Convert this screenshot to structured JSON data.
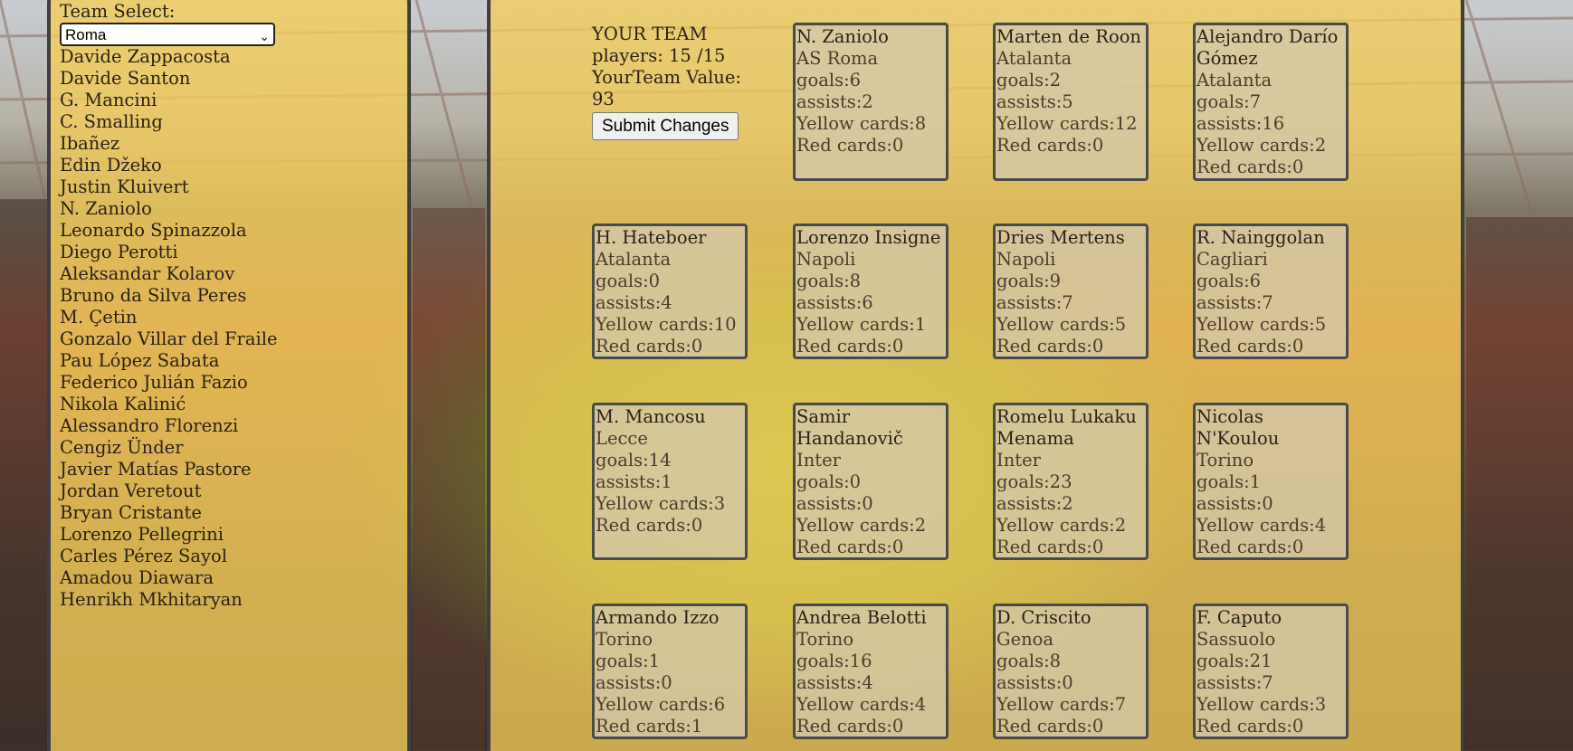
{
  "sidebar": {
    "team_select_label": "Team Select:",
    "selected_team": "Roma",
    "roster": [
      "Davide Zappacosta",
      "Davide Santon",
      "G. Mancini",
      "C. Smalling",
      "Ibañez",
      "Edin Džeko",
      "Justin Kluivert",
      "N. Zaniolo",
      "Leonardo Spinazzola",
      "Diego Perotti",
      "Aleksandar Kolarov",
      "Bruno da Silva Peres",
      "M. Çetin",
      "Gonzalo Villar del Fraile",
      "Pau López Sabata",
      "Federico Julián Fazio",
      "Nikola Kalinić",
      "Alessandro Florenzi",
      "Cengiz Ünder",
      "Javier Matías Pastore",
      "Jordan Veretout",
      "Bryan Cristante",
      "Lorenzo Pellegrini",
      "Carles Pérez Sayol",
      "Amadou Diawara",
      "Henrikh Mkhitaryan"
    ]
  },
  "team": {
    "heading": "YOUR TEAM",
    "players_text": "players: 15 /15",
    "value_label": "YourTeam Value:",
    "value": "93",
    "submit_label": "Submit Changes"
  },
  "cards": [
    {
      "name": "N. Zaniolo",
      "club": "AS Roma",
      "goals": "goals:6",
      "assists": "assists:2",
      "yellow": "Yellow cards:8",
      "red": "Red cards:0"
    },
    {
      "name": "Marten de Roon",
      "club": "Atalanta",
      "goals": "goals:2",
      "assists": "assists:5",
      "yellow": "Yellow cards:12",
      "red": "Red cards:0"
    },
    {
      "name": "Alejandro Darío Gómez",
      "club": "Atalanta",
      "goals": "goals:7",
      "assists": "assists:16",
      "yellow": "Yellow cards:2",
      "red": "Red cards:0"
    },
    {
      "name": "H. Hateboer",
      "club": "Atalanta",
      "goals": "goals:0",
      "assists": "assists:4",
      "yellow": "Yellow cards:10",
      "red": "Red cards:0"
    },
    {
      "name": "Lorenzo Insigne",
      "club": "Napoli",
      "goals": "goals:8",
      "assists": "assists:6",
      "yellow": "Yellow cards:1",
      "red": "Red cards:0"
    },
    {
      "name": "Dries Mertens",
      "club": "Napoli",
      "goals": "goals:9",
      "assists": "assists:7",
      "yellow": "Yellow cards:5",
      "red": "Red cards:0"
    },
    {
      "name": "R. Nainggolan",
      "club": "Cagliari",
      "goals": "goals:6",
      "assists": "assists:7",
      "yellow": "Yellow cards:5",
      "red": "Red cards:0"
    },
    {
      "name": "M. Mancosu",
      "club": "Lecce",
      "goals": "goals:14",
      "assists": "assists:1",
      "yellow": "Yellow cards:3",
      "red": "Red cards:0"
    },
    {
      "name": "Samir Handanovič",
      "club": "Inter",
      "goals": "goals:0",
      "assists": "assists:0",
      "yellow": "Yellow cards:2",
      "red": "Red cards:0"
    },
    {
      "name": "Romelu Lukaku Menama",
      "club": "Inter",
      "goals": "goals:23",
      "assists": "assists:2",
      "yellow": "Yellow cards:2",
      "red": "Red cards:0"
    },
    {
      "name": "Nicolas N'Koulou",
      "club": "Torino",
      "goals": "goals:1",
      "assists": "assists:0",
      "yellow": "Yellow cards:4",
      "red": "Red cards:0"
    },
    {
      "name": "Armando Izzo",
      "club": "Torino",
      "goals": "goals:1",
      "assists": "assists:0",
      "yellow": "Yellow cards:6",
      "red": "Red cards:1"
    },
    {
      "name": "Andrea Belotti",
      "club": "Torino",
      "goals": "goals:16",
      "assists": "assists:4",
      "yellow": "Yellow cards:4",
      "red": "Red cards:0"
    },
    {
      "name": "D. Criscito",
      "club": "Genoa",
      "goals": "goals:8",
      "assists": "assists:0",
      "yellow": "Yellow cards:7",
      "red": "Red cards:0"
    },
    {
      "name": "F. Caputo",
      "club": "Sassuolo",
      "goals": "goals:21",
      "assists": "assists:7",
      "yellow": "Yellow cards:3",
      "red": "Red cards:0"
    }
  ]
}
